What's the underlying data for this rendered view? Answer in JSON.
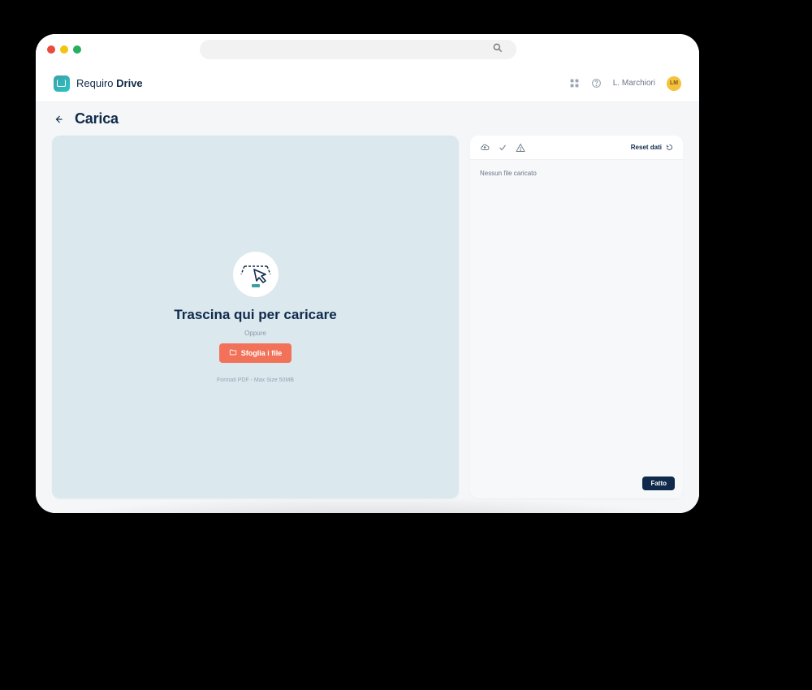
{
  "app": {
    "brand_prefix": "Requiro ",
    "brand_bold": "Drive",
    "user_name": "L. Marchiori",
    "user_initials": "LM"
  },
  "page": {
    "title": "Carica"
  },
  "dropzone": {
    "title": "Trascina qui per caricare",
    "or": "Oppure",
    "browse_label": "Sfoglia i file",
    "hint": "Formati PDF - Max Size 50MB"
  },
  "sidepanel": {
    "reset_label": "Reset dati",
    "empty_text": "Nessun file caricato",
    "done_label": "Fatto"
  },
  "colors": {
    "accent": "#f27259",
    "ink": "#0f2a4a"
  }
}
